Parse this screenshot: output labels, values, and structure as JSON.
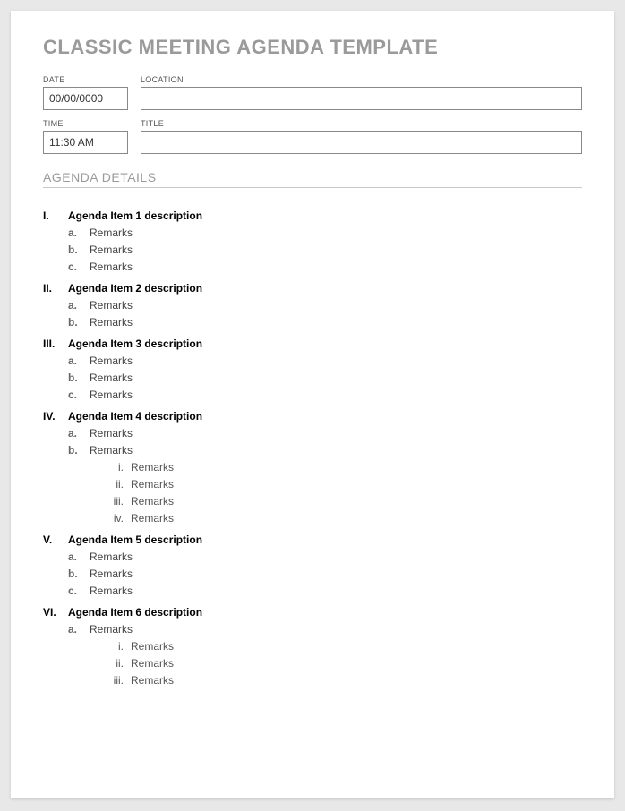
{
  "title": "CLASSIC MEETING AGENDA TEMPLATE",
  "fields": {
    "date": {
      "label": "DATE",
      "value": "00/00/0000"
    },
    "location": {
      "label": "LOCATION",
      "value": ""
    },
    "time": {
      "label": "TIME",
      "value": "11:30 AM"
    },
    "meeting_title": {
      "label": "TITLE",
      "value": ""
    }
  },
  "section_header": "AGENDA DETAILS",
  "agenda": [
    {
      "marker": "I.",
      "label": "Agenda Item 1 description",
      "children": [
        {
          "marker": "a.",
          "label": "Remarks"
        },
        {
          "marker": "b.",
          "label": "Remarks"
        },
        {
          "marker": "c.",
          "label": "Remarks"
        }
      ]
    },
    {
      "marker": "II.",
      "label": "Agenda Item 2 description",
      "children": [
        {
          "marker": "a.",
          "label": "Remarks"
        },
        {
          "marker": "b.",
          "label": "Remarks"
        }
      ]
    },
    {
      "marker": "III.",
      "label": "Agenda Item 3 description",
      "children": [
        {
          "marker": "a.",
          "label": "Remarks"
        },
        {
          "marker": "b.",
          "label": "Remarks"
        },
        {
          "marker": "c.",
          "label": "Remarks"
        }
      ]
    },
    {
      "marker": "IV.",
      "label": "Agenda Item 4 description",
      "children": [
        {
          "marker": "a.",
          "label": "Remarks"
        },
        {
          "marker": "b.",
          "label": "Remarks",
          "children": [
            {
              "marker": "i.",
              "label": "Remarks"
            },
            {
              "marker": "ii.",
              "label": "Remarks"
            },
            {
              "marker": "iii.",
              "label": "Remarks"
            },
            {
              "marker": "iv.",
              "label": "Remarks"
            }
          ]
        }
      ]
    },
    {
      "marker": "V.",
      "label": "Agenda Item 5 description",
      "children": [
        {
          "marker": "a.",
          "label": "Remarks"
        },
        {
          "marker": "b.",
          "label": "Remarks"
        },
        {
          "marker": "c.",
          "label": "Remarks"
        }
      ]
    },
    {
      "marker": "VI.",
      "label": "Agenda Item 6 description",
      "children": [
        {
          "marker": "a.",
          "label": "Remarks",
          "children": [
            {
              "marker": "i.",
              "label": "Remarks"
            },
            {
              "marker": "ii.",
              "label": "Remarks"
            },
            {
              "marker": "iii.",
              "label": "Remarks"
            }
          ]
        }
      ]
    }
  ]
}
